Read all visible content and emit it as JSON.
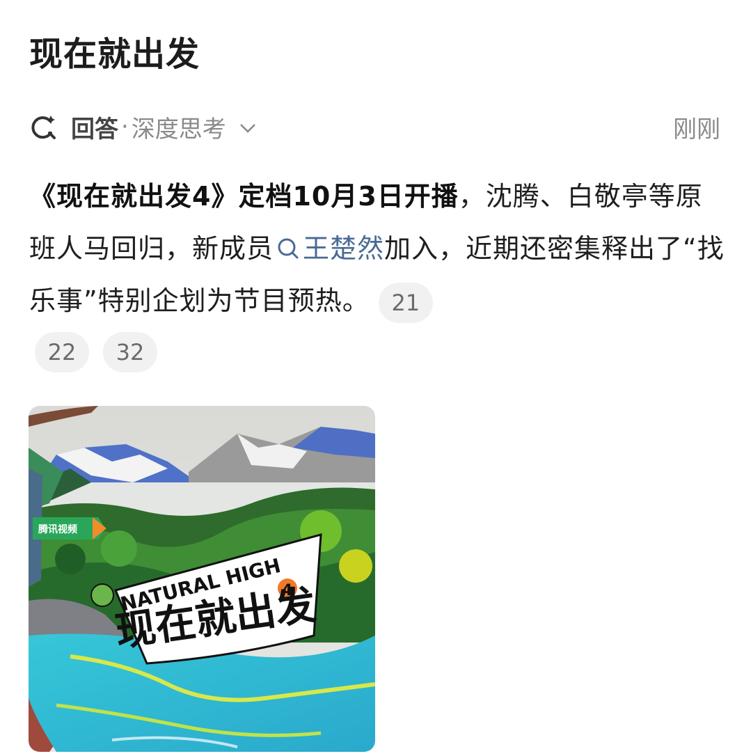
{
  "header": {
    "title": "现在就出发"
  },
  "answer": {
    "label": "回答",
    "separator": "·",
    "mode": "深度思考",
    "time": "刚刚"
  },
  "content": {
    "bold_text": "《现在就出发4》定档10月3日开播",
    "text_1": "，沈腾、白敬亭等原班人马回归，新成员",
    "entity": "王楚然",
    "text_2": "加入，近期还密集释出了“找乐事”特别企划为节目预热。",
    "refs": [
      "21",
      "22",
      "32"
    ]
  },
  "poster": {
    "platform": "腾讯视频",
    "logo_en": "NATURAL HIGH",
    "season": "4",
    "logo_cn": "现在就出发"
  }
}
